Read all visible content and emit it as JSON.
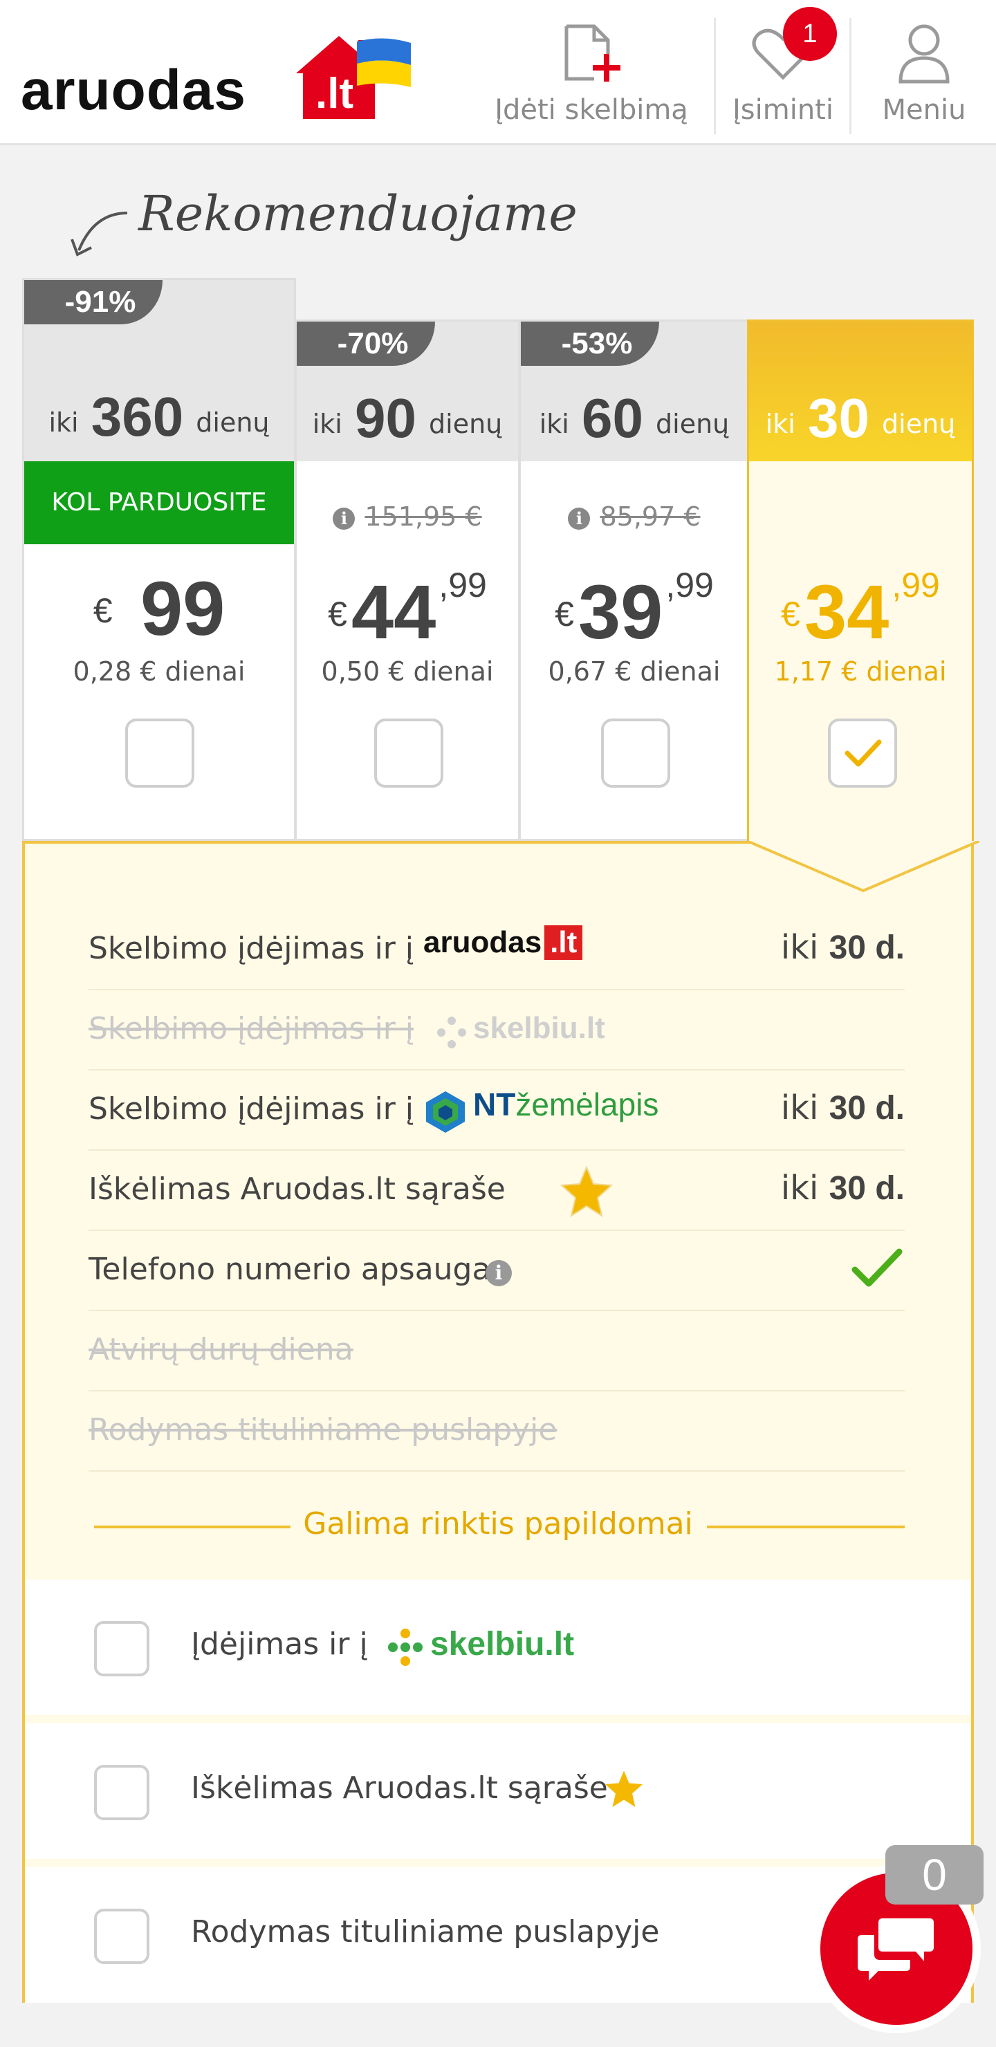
{
  "header": {
    "logo_text": "aruodas",
    "logo_suffix": ".lt",
    "nav": {
      "add_label": "Įdėti skelbimą",
      "fav_label": "Įsiminti",
      "fav_badge": "1",
      "menu_label": "Meniu"
    }
  },
  "recommend_label": "Rekomenduojame",
  "plans": [
    {
      "discount": "-91%",
      "prefix": "iki",
      "days": "360",
      "suffix": "dienų",
      "banner": "KOL PARDUOSITE",
      "old_price": "",
      "currency": "€",
      "price_int": "99",
      "price_dec": "",
      "per_day": "0,28 € dienai",
      "selected": false
    },
    {
      "discount": "-70%",
      "prefix": "iki",
      "days": "90",
      "suffix": "dienų",
      "old_price": "151,95 €",
      "currency": "€",
      "price_int": "44",
      "price_dec": ",99",
      "per_day": "0,50 € dienai",
      "selected": false
    },
    {
      "discount": "-53%",
      "prefix": "iki",
      "days": "60",
      "suffix": "dienų",
      "old_price": "85,97 €",
      "currency": "€",
      "price_int": "39",
      "price_dec": ",99",
      "per_day": "0,67 € dienai",
      "selected": false
    },
    {
      "discount": "",
      "prefix": "iki",
      "days": "30",
      "suffix": "dienų",
      "old_price": "",
      "currency": "€",
      "price_int": "34",
      "price_dec": ",99",
      "per_day": "1,17 € dienai",
      "selected": true
    }
  ],
  "features": [
    {
      "text": "Skelbimo įdėjimas ir į",
      "logo": "aruodas.lt",
      "value_prefix": "iki",
      "value": "30 d.",
      "enabled": true
    },
    {
      "text": "Skelbimo įdėjimas ir į",
      "logo": "skelbiu.lt",
      "value_prefix": "",
      "value": "",
      "enabled": false
    },
    {
      "text": "Skelbimo įdėjimas ir į",
      "logo": "NTžemėlapis",
      "value_prefix": "iki",
      "value": "30 d.",
      "enabled": true
    },
    {
      "text": "Iškėlimas Aruodas.lt sąraše",
      "logo": "",
      "value_prefix": "iki",
      "value": "30 d.",
      "enabled": true
    },
    {
      "text": "Telefono numerio apsauga",
      "logo": "",
      "value_prefix": "",
      "value": "",
      "enabled": true
    },
    {
      "text": "Atvirų durų diena",
      "logo": "",
      "value_prefix": "",
      "value": "",
      "enabled": false
    },
    {
      "text": "Rodymas tituliniame puslapyje",
      "logo": "",
      "value_prefix": "",
      "value": "",
      "enabled": false
    }
  ],
  "logos": {
    "aruodas_main": "aruodas",
    "aruodas_lt": ".lt",
    "skelbiu": "skelbiu.lt",
    "nt_bold": "NT",
    "nt_rest": "žemėlapis"
  },
  "extras_title": "Galima rinktis papildomai",
  "extras": [
    {
      "text": "Įdėjimas ir į",
      "logo": "skelbiu.lt",
      "checked": false
    },
    {
      "text": "Iškėlimas Aruodas.lt sąraše",
      "logo": "",
      "checked": false
    },
    {
      "text": "Rodymas tituliniame puslapyje",
      "logo": "",
      "checked": false
    }
  ],
  "chat": {
    "count": "0"
  },
  "colors": {
    "brand_red": "#e2001a",
    "accent_yellow": "#f0b400",
    "green": "#0fa018",
    "check_green": "#4caf1a"
  }
}
